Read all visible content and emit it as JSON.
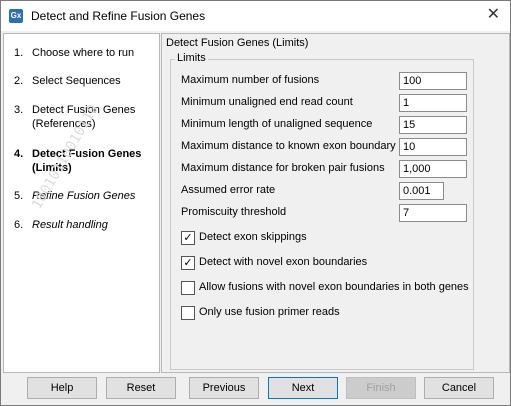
{
  "window": {
    "title": "Detect and Refine Fusion Genes",
    "app_icon": "Gx"
  },
  "steps": [
    {
      "num": "1.",
      "label": "Choose where to run"
    },
    {
      "num": "2.",
      "label": "Select Sequences"
    },
    {
      "num": "3.",
      "label": "Detect Fusion Genes (References)"
    },
    {
      "num": "4.",
      "label": "Detect Fusion Genes (Limits)"
    },
    {
      "num": "5.",
      "label": "Refine Fusion Genes"
    },
    {
      "num": "6.",
      "label": "Result handling"
    }
  ],
  "sidebar_watermark": "10010110010110",
  "content": {
    "title": "Detect Fusion Genes (Limits)",
    "group_label": "Limits",
    "fields": [
      {
        "label": "Maximum number of fusions",
        "value": "100"
      },
      {
        "label": "Minimum unaligned end read count",
        "value": "1"
      },
      {
        "label": "Minimum length of unaligned sequence",
        "value": "15"
      },
      {
        "label": "Maximum distance to known exon boundary",
        "value": "10"
      },
      {
        "label": "Maximum distance for broken pair fusions",
        "value": "1,000"
      },
      {
        "label": "Assumed error rate",
        "value": "0.001"
      },
      {
        "label": "Promiscuity threshold",
        "value": "7"
      }
    ],
    "checkboxes": [
      {
        "label": "Detect exon skippings",
        "checked": true
      },
      {
        "label": "Detect with novel exon boundaries",
        "checked": true
      },
      {
        "label": "Allow fusions with novel exon boundaries in both genes",
        "checked": false
      },
      {
        "label": "Only use fusion primer reads",
        "checked": false
      }
    ]
  },
  "buttons": {
    "help": "Help",
    "reset": "Reset",
    "previous": "Previous",
    "next": "Next",
    "finish": "Finish",
    "cancel": "Cancel"
  },
  "icons": {
    "close": "close-icon",
    "app": "app-icon",
    "checkmark": "checkmark-icon"
  },
  "colors": {
    "accent": "#0078d7",
    "disabled_text": "#a0a0a0"
  }
}
